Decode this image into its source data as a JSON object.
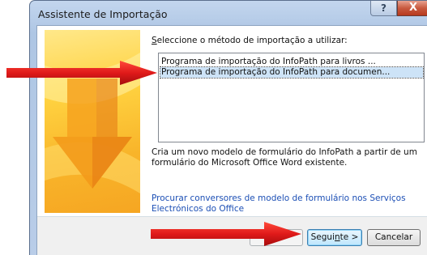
{
  "window": {
    "title": "Assistente de Importação",
    "help_label": "?",
    "close_label": "X"
  },
  "dialog": {
    "instruction_pre": "S",
    "instruction_rest": "eleccione o método de importação a utilizar:",
    "list_items": [
      {
        "label": "Programa de importação do InfoPath para livros ...",
        "selected": false
      },
      {
        "label": "Programa de importação do InfoPath para documen...",
        "selected": true
      }
    ],
    "description": "Cria um novo modelo de formulário do InfoPath a partir de um formulário do Microsoft Office Word existente.",
    "link": "Procurar conversores de modelo de formulário nos Serviços Electrónicos do Office"
  },
  "footer": {
    "next_pre": "Segui",
    "next_accel": "n",
    "next_post": "te >",
    "cancel_label": "Cancelar"
  },
  "colors": {
    "annotation_arrow": "#e01a1a",
    "link": "#1c4fb5",
    "selection": "#cde3f7"
  }
}
